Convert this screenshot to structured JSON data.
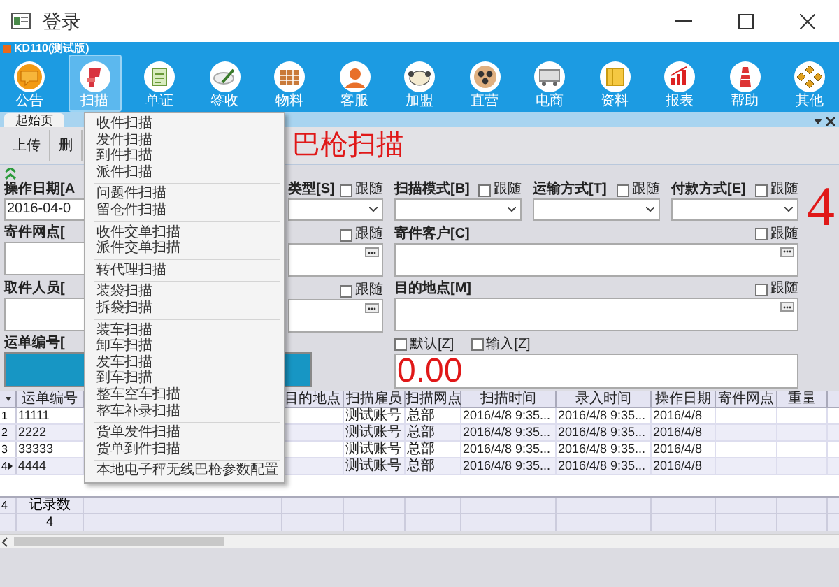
{
  "window": {
    "title": "登录"
  },
  "app": {
    "name": "KD110(测试版)"
  },
  "toolbar": [
    {
      "label": "公告",
      "selected": false
    },
    {
      "label": "扫描",
      "selected": true
    },
    {
      "label": "单证",
      "selected": false
    },
    {
      "label": "签收",
      "selected": false
    },
    {
      "label": "物料",
      "selected": false
    },
    {
      "label": "客服",
      "selected": false
    },
    {
      "label": "加盟",
      "selected": false
    },
    {
      "label": "直营",
      "selected": false
    },
    {
      "label": "电商",
      "selected": false
    },
    {
      "label": "资料",
      "selected": false
    },
    {
      "label": "报表",
      "selected": false
    },
    {
      "label": "帮助",
      "selected": false
    },
    {
      "label": "其他",
      "selected": false
    }
  ],
  "tabs": [
    {
      "label": "起始页",
      "selected": true
    }
  ],
  "actions": [
    "上传",
    "删"
  ],
  "page_title": "巴枪扫描",
  "form": {
    "date": {
      "label": "操作日期[A",
      "value": "2016-04-0"
    },
    "left_labels": [
      "寄件网点[",
      "取件人员[",
      "运单编号["
    ],
    "type": {
      "label": "类型[S]",
      "follow": {
        "label": "跟随",
        "checked": false
      }
    },
    "middle_boxes": [
      {
        "follow": {
          "label": "跟随",
          "checked": false
        }
      },
      {
        "follow": {
          "label": "跟随",
          "checked": false
        }
      }
    ],
    "selects": [
      {
        "label": "扫描模式[B]",
        "follow": {
          "label": "跟随",
          "checked": false
        }
      },
      {
        "label": "运输方式[T]",
        "follow": {
          "label": "跟随",
          "checked": false
        }
      },
      {
        "label": "付款方式[E]",
        "follow": {
          "label": "跟随",
          "checked": false
        }
      }
    ],
    "wide_boxes": [
      {
        "label": "寄件客户[C]",
        "follow": {
          "label": "跟随",
          "checked": false
        }
      },
      {
        "label": "目的地点[M]",
        "follow": {
          "label": "跟随",
          "checked": false
        }
      }
    ],
    "weight_options": [
      {
        "label": "默认[Z]",
        "checked": false
      },
      {
        "label": "输入[Z]",
        "checked": false
      }
    ],
    "weight": "0.00"
  },
  "counter": "4",
  "grid": {
    "columns": [
      "运单编号",
      "目的地点",
      "扫描雇员",
      "扫描网点",
      "扫描时间",
      "录入时间",
      "操作日期",
      "寄件网点",
      "重量"
    ],
    "rows": [
      {
        "number": "1",
        "current": false,
        "waybill": "11111",
        "employee": "测试账号",
        "site": "总部",
        "scan_time": "2016/4/8 9:35...",
        "entry_time": "2016/4/8 9:35...",
        "date": "2016/4/8"
      },
      {
        "number": "2",
        "current": false,
        "waybill": "2222",
        "employee": "测试账号",
        "site": "总部",
        "scan_time": "2016/4/8 9:35...",
        "entry_time": "2016/4/8 9:35...",
        "date": "2016/4/8"
      },
      {
        "number": "3",
        "current": false,
        "waybill": "33333",
        "employee": "测试账号",
        "site": "总部",
        "scan_time": "2016/4/8 9:35...",
        "entry_time": "2016/4/8 9:35...",
        "date": "2016/4/8"
      },
      {
        "number": "4",
        "current": true,
        "waybill": "4444",
        "employee": "测试账号",
        "site": "总部",
        "scan_time": "2016/4/8 9:35...",
        "entry_time": "2016/4/8 9:35...",
        "date": "2016/4/8"
      }
    ],
    "footer": {
      "count": "4",
      "label": "记录数",
      "value": "4"
    }
  },
  "menu": {
    "groups": [
      [
        "收件扫描",
        "发件扫描",
        "到件扫描",
        "派件扫描"
      ],
      [
        "问题件扫描",
        "留仓件扫描"
      ],
      [
        "收件交单扫描",
        "派件交单扫描"
      ],
      [
        "转代理扫描"
      ],
      [
        "装袋扫描",
        "拆袋扫描"
      ],
      [
        "装车扫描",
        "卸车扫描",
        "发车扫描",
        "到车扫描",
        "整车空车扫描",
        "整车补录扫描"
      ],
      [
        "货单发件扫描",
        "货单到件扫描"
      ],
      [
        "本地电子秤无线巴枪参数配置"
      ]
    ]
  }
}
